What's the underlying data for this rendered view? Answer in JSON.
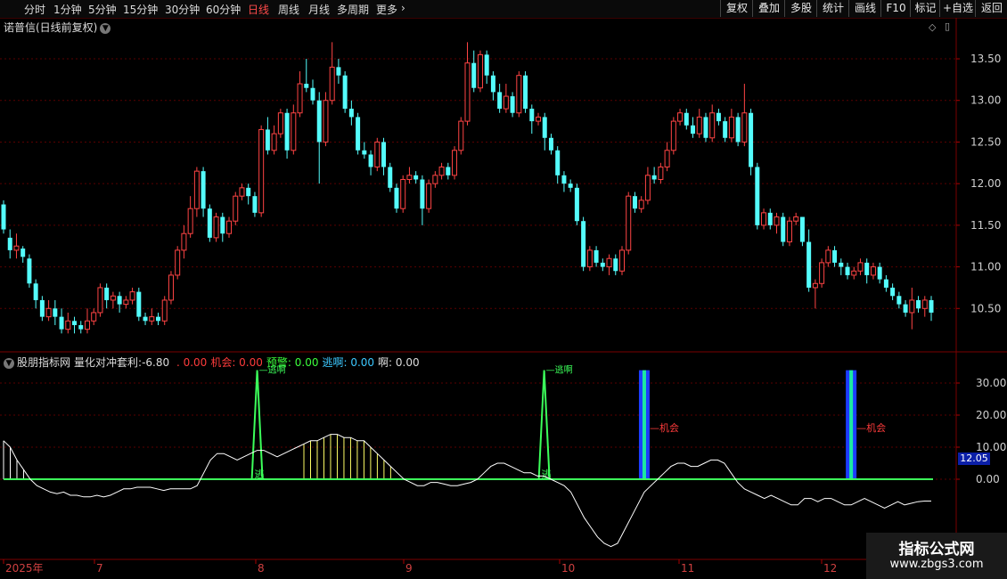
{
  "periods": [
    "分时",
    "1分钟",
    "5分钟",
    "15分钟",
    "30分钟",
    "60分钟",
    "日线",
    "周线",
    "月线",
    "多周期",
    "更多"
  ],
  "active_period": "日线",
  "more_chevron": "›",
  "right_buttons": [
    "复权",
    "叠加",
    "多股",
    "统计",
    "画线",
    "F10",
    "标记",
    "+自选",
    "返回"
  ],
  "stock_title": "诺普信(日线前复权)",
  "indicator": {
    "source": "股朋指标网",
    "name": "量化对冲套利:",
    "value": "-6.80",
    "fields": [
      {
        "label": "",
        "value": "0.00",
        "color": "#ff3b3b"
      },
      {
        "label": "机会:",
        "value": "0.00",
        "color": "#ff3b3b"
      },
      {
        "label": "预警:",
        "value": "0.00",
        "color": "#3cff3c"
      },
      {
        "label": "逃啊:",
        "value": "0.00",
        "color": "#3cc8ff"
      },
      {
        "label": "啊:",
        "value": "0.00",
        "color": "#dddddd"
      }
    ]
  },
  "price_axis": [
    "13.50",
    "13.00",
    "12.50",
    "12.00",
    "11.50",
    "11.00",
    "10.50"
  ],
  "ind_axis": [
    "30.00",
    "20.00",
    "10.00",
    "0.00"
  ],
  "current_value_tag": "12.05",
  "date_axis": [
    "2025年",
    "7",
    "8",
    "9",
    "10",
    "11",
    "12"
  ],
  "annotations": {
    "escape_top": "逃啊",
    "escape_bottom": "逃",
    "chance": "机会"
  },
  "watermark": {
    "line1": "指标公式网",
    "line2": "www.zbgs3.com"
  },
  "colors": {
    "up": "#ff4444",
    "down": "#54fcfc",
    "grid": "#5a0000",
    "green": "#3cff5a",
    "blue": "#1c3cff"
  },
  "chart_data": {
    "type": "candlestick",
    "ylim": [
      10.0,
      13.8
    ],
    "candles": [
      [
        11.75,
        11.45,
        11.8,
        11.4
      ],
      [
        11.35,
        11.2,
        11.45,
        11.1
      ],
      [
        11.2,
        11.25,
        11.4,
        11.1
      ],
      [
        11.22,
        11.12,
        11.25,
        11.05
      ],
      [
        11.1,
        10.8,
        11.15,
        10.75
      ],
      [
        10.8,
        10.6,
        10.85,
        10.5
      ],
      [
        10.6,
        10.4,
        10.65,
        10.35
      ],
      [
        10.4,
        10.5,
        10.6,
        10.35
      ],
      [
        10.5,
        10.4,
        10.6,
        10.3
      ],
      [
        10.4,
        10.25,
        10.5,
        10.2
      ],
      [
        10.25,
        10.35,
        10.45,
        10.2
      ],
      [
        10.35,
        10.3,
        10.4,
        10.2
      ],
      [
        10.3,
        10.25,
        10.35,
        10.2
      ],
      [
        10.25,
        10.35,
        10.5,
        10.2
      ],
      [
        10.35,
        10.45,
        10.5,
        10.3
      ],
      [
        10.45,
        10.75,
        10.8,
        10.4
      ],
      [
        10.75,
        10.6,
        10.8,
        10.5
      ],
      [
        10.6,
        10.65,
        10.7,
        10.5
      ],
      [
        10.65,
        10.55,
        10.7,
        10.45
      ],
      [
        10.55,
        10.6,
        10.65,
        10.5
      ],
      [
        10.6,
        10.7,
        10.75,
        10.55
      ],
      [
        10.7,
        10.4,
        10.75,
        10.35
      ],
      [
        10.4,
        10.35,
        10.45,
        10.3
      ],
      [
        10.35,
        10.4,
        10.5,
        10.3
      ],
      [
        10.4,
        10.35,
        10.45,
        10.3
      ],
      [
        10.35,
        10.6,
        10.65,
        10.3
      ],
      [
        10.6,
        10.9,
        10.95,
        10.55
      ],
      [
        10.9,
        11.2,
        11.25,
        10.85
      ],
      [
        11.2,
        11.4,
        11.5,
        11.1
      ],
      [
        11.4,
        11.7,
        11.85,
        11.35
      ],
      [
        11.7,
        12.15,
        12.2,
        11.6
      ],
      [
        12.15,
        11.7,
        12.2,
        11.6
      ],
      [
        11.7,
        11.35,
        11.75,
        11.3
      ],
      [
        11.35,
        11.6,
        11.65,
        11.3
      ],
      [
        11.6,
        11.4,
        11.65,
        11.3
      ],
      [
        11.4,
        11.55,
        11.6,
        11.35
      ],
      [
        11.55,
        11.85,
        11.9,
        11.5
      ],
      [
        11.85,
        11.95,
        12.0,
        11.8
      ],
      [
        11.95,
        11.85,
        12.0,
        11.75
      ],
      [
        11.85,
        11.65,
        11.9,
        11.6
      ],
      [
        11.65,
        12.65,
        12.7,
        11.6
      ],
      [
        12.65,
        12.4,
        12.8,
        12.35
      ],
      [
        12.4,
        12.6,
        12.7,
        12.35
      ],
      [
        12.6,
        12.85,
        12.9,
        12.55
      ],
      [
        12.85,
        12.4,
        12.9,
        12.3
      ],
      [
        12.4,
        12.85,
        12.95,
        12.35
      ],
      [
        12.85,
        13.2,
        13.35,
        12.8
      ],
      [
        13.2,
        13.15,
        13.5,
        13.1
      ],
      [
        13.15,
        13.0,
        13.25,
        12.95
      ],
      [
        13.0,
        12.5,
        13.1,
        12.0
      ],
      [
        12.5,
        13.0,
        13.1,
        12.45
      ],
      [
        13.0,
        13.4,
        13.7,
        12.95
      ],
      [
        13.4,
        13.3,
        13.5,
        13.2
      ],
      [
        13.3,
        12.9,
        13.35,
        12.85
      ],
      [
        12.9,
        12.8,
        13.0,
        12.7
      ],
      [
        12.8,
        12.4,
        12.85,
        12.35
      ],
      [
        12.4,
        12.35,
        12.5,
        12.3
      ],
      [
        12.35,
        12.2,
        12.4,
        12.1
      ],
      [
        12.2,
        12.5,
        12.55,
        12.15
      ],
      [
        12.5,
        12.2,
        12.55,
        12.1
      ],
      [
        12.2,
        11.95,
        12.25,
        11.9
      ],
      [
        11.95,
        11.7,
        12.0,
        11.65
      ],
      [
        11.7,
        12.05,
        12.1,
        11.65
      ],
      [
        12.05,
        12.1,
        12.2,
        12.0
      ],
      [
        12.1,
        12.05,
        12.15,
        12.0
      ],
      [
        12.05,
        11.7,
        12.1,
        11.5
      ],
      [
        11.7,
        12.0,
        12.05,
        11.65
      ],
      [
        12.0,
        12.1,
        12.15,
        11.95
      ],
      [
        12.1,
        12.2,
        12.25,
        12.05
      ],
      [
        12.2,
        12.1,
        12.25,
        12.05
      ],
      [
        12.1,
        12.4,
        12.45,
        12.05
      ],
      [
        12.4,
        12.75,
        12.8,
        12.35
      ],
      [
        12.75,
        13.45,
        13.7,
        12.7
      ],
      [
        13.45,
        13.15,
        13.6,
        13.1
      ],
      [
        13.15,
        13.55,
        13.6,
        13.1
      ],
      [
        13.55,
        13.3,
        13.6,
        13.2
      ],
      [
        13.3,
        13.1,
        13.35,
        13.0
      ],
      [
        13.1,
        12.9,
        13.2,
        12.85
      ],
      [
        12.9,
        13.05,
        13.2,
        12.85
      ],
      [
        13.05,
        12.85,
        13.1,
        12.8
      ],
      [
        12.85,
        13.3,
        13.35,
        12.8
      ],
      [
        13.3,
        12.9,
        13.35,
        12.85
      ],
      [
        12.9,
        12.75,
        12.95,
        12.6
      ],
      [
        12.75,
        12.8,
        12.85,
        12.7
      ],
      [
        12.8,
        12.55,
        12.85,
        12.4
      ],
      [
        12.55,
        12.4,
        12.6,
        12.35
      ],
      [
        12.4,
        12.1,
        12.45,
        12.0
      ],
      [
        12.1,
        12.0,
        12.15,
        11.9
      ],
      [
        12.0,
        11.95,
        12.05,
        11.9
      ],
      [
        11.95,
        11.55,
        12.0,
        11.5
      ],
      [
        11.55,
        11.0,
        11.6,
        10.95
      ],
      [
        11.0,
        11.2,
        11.25,
        10.95
      ],
      [
        11.2,
        11.05,
        11.25,
        11.0
      ],
      [
        11.05,
        11.0,
        11.1,
        10.95
      ],
      [
        11.0,
        11.1,
        11.15,
        10.9
      ],
      [
        11.1,
        10.95,
        11.15,
        10.9
      ],
      [
        10.95,
        11.2,
        11.25,
        10.9
      ],
      [
        11.2,
        11.85,
        11.9,
        11.15
      ],
      [
        11.85,
        11.7,
        11.9,
        11.65
      ],
      [
        11.7,
        11.8,
        11.85,
        11.65
      ],
      [
        11.8,
        12.1,
        12.2,
        11.75
      ],
      [
        12.1,
        12.05,
        12.2,
        12.0
      ],
      [
        12.05,
        12.2,
        12.25,
        12.0
      ],
      [
        12.2,
        12.4,
        12.5,
        12.15
      ],
      [
        12.4,
        12.75,
        12.8,
        12.35
      ],
      [
        12.75,
        12.85,
        12.9,
        12.7
      ],
      [
        12.85,
        12.7,
        12.9,
        12.65
      ],
      [
        12.7,
        12.6,
        12.8,
        12.55
      ],
      [
        12.6,
        12.8,
        12.9,
        12.55
      ],
      [
        12.8,
        12.55,
        12.85,
        12.5
      ],
      [
        12.55,
        12.85,
        12.95,
        12.5
      ],
      [
        12.85,
        12.75,
        12.9,
        12.7
      ],
      [
        12.75,
        12.55,
        12.8,
        12.5
      ],
      [
        12.55,
        12.8,
        12.9,
        12.5
      ],
      [
        12.8,
        12.5,
        12.85,
        12.45
      ],
      [
        12.5,
        12.85,
        13.2,
        12.45
      ],
      [
        12.85,
        12.2,
        12.9,
        12.1
      ],
      [
        12.2,
        11.5,
        12.25,
        11.45
      ],
      [
        11.5,
        11.65,
        11.7,
        11.45
      ],
      [
        11.65,
        11.5,
        11.7,
        11.45
      ],
      [
        11.5,
        11.6,
        11.65,
        11.4
      ],
      [
        11.6,
        11.3,
        11.65,
        11.25
      ],
      [
        11.3,
        11.55,
        11.6,
        11.25
      ],
      [
        11.55,
        11.6,
        11.65,
        11.5
      ],
      [
        11.6,
        11.3,
        11.6,
        11.25
      ],
      [
        11.3,
        10.75,
        11.45,
        10.7
      ],
      [
        10.75,
        10.8,
        10.85,
        10.5
      ],
      [
        10.8,
        11.05,
        11.1,
        10.75
      ],
      [
        11.05,
        11.2,
        11.25,
        11.0
      ],
      [
        11.2,
        11.05,
        11.25,
        11.0
      ],
      [
        11.05,
        11.0,
        11.1,
        10.9
      ],
      [
        11.0,
        10.9,
        11.05,
        10.85
      ],
      [
        10.9,
        10.95,
        11.0,
        10.85
      ],
      [
        10.95,
        11.05,
        11.1,
        10.9
      ],
      [
        11.05,
        10.9,
        11.1,
        10.8
      ],
      [
        10.9,
        11.0,
        11.05,
        10.85
      ],
      [
        11.0,
        10.85,
        11.05,
        10.8
      ],
      [
        10.85,
        10.75,
        10.9,
        10.7
      ],
      [
        10.75,
        10.65,
        10.8,
        10.6
      ],
      [
        10.65,
        10.55,
        10.7,
        10.5
      ],
      [
        10.55,
        10.45,
        10.6,
        10.4
      ],
      [
        10.45,
        10.6,
        10.75,
        10.25
      ],
      [
        10.6,
        10.5,
        10.65,
        10.45
      ],
      [
        10.5,
        10.6,
        10.65,
        10.4
      ],
      [
        10.6,
        10.45,
        10.65,
        10.35
      ]
    ],
    "indicator_line": [
      12,
      10,
      6,
      3,
      0,
      -2,
      -3,
      -4,
      -4.5,
      -4,
      -5,
      -5,
      -5.5,
      -5.5,
      -5,
      -5.5,
      -5,
      -4,
      -3,
      -3,
      -2.5,
      -2.5,
      -2.5,
      -3,
      -3.5,
      -3,
      -3,
      -3,
      -3,
      -2,
      2,
      6,
      8,
      8,
      7,
      6,
      7,
      8,
      9,
      9,
      8,
      7,
      8,
      9,
      10,
      11,
      12,
      12,
      13,
      14,
      14,
      13,
      13,
      12,
      12,
      10,
      8,
      6,
      4,
      2,
      0,
      -1,
      -2,
      -2,
      -1,
      -1,
      -1.5,
      -2,
      -2,
      -1.5,
      -1,
      0,
      2,
      4,
      5,
      5,
      4,
      3,
      2,
      2,
      1,
      1,
      0,
      -1,
      -2,
      -4,
      -8,
      -12,
      -15,
      -18,
      -20,
      -21,
      -20,
      -16,
      -12,
      -8,
      -4,
      -2,
      0,
      2,
      4,
      5,
      5,
      4,
      4,
      5,
      6,
      6,
      5,
      2,
      -1,
      -3,
      -4,
      -5,
      -6,
      -5,
      -6,
      -7,
      -8,
      -8,
      -6,
      -6,
      -7,
      -6,
      -6,
      -7,
      -8,
      -8,
      -7,
      -6,
      -7,
      -8,
      -9,
      -8,
      -7,
      -8,
      -7.5,
      -7,
      -6.8,
      -6.8
    ],
    "escape_events": [
      38,
      81
    ],
    "chance_events": [
      96,
      127
    ],
    "yellow_zone": [
      45,
      58
    ],
    "ind_ylim": [
      -25,
      35
    ]
  }
}
